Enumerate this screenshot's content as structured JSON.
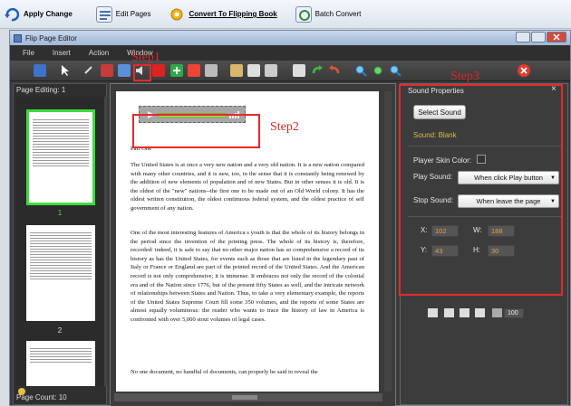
{
  "toolbar": {
    "apply_change": "Apply Change",
    "edit_pages": "Edit Pages",
    "convert": "Convert To Flipping Book",
    "batch_convert": "Batch Convert"
  },
  "window": {
    "title": "Flip Page Editor"
  },
  "menu": [
    "File",
    "Insert",
    "Action",
    "Window"
  ],
  "left_panel": {
    "page_editing": "Page Editing: 1",
    "page_count": "Page Count: 10",
    "thumbnails": [
      {
        "number": "1",
        "selected": true
      },
      {
        "number": "2",
        "selected": false
      }
    ]
  },
  "page": {
    "part_heading": "Part One",
    "paragraphs": [
      "The United States is at once a very new nation and a very old nation. It is a new nation compared with many other countries, and it is new, too, in the sense that it is constantly being renewed by the addition of new elements of population and of new States. But in other senses it is old. It is the oldest of the \"new\" nations--the first one to be made out of an Old World colony. It has the oldest written constitution, the oldest continuous federal system, and the oldest practice of self    government of any nation.",
      "One of the most interesting features of America    s youth is that the whole of its history belongs in the period since the invention of the printing press. The whole of its history is, therefore, recorded: indeed, it is safe to say that no other major nation has so comprehensive a record of its history as has the United States, for events such as those that are listed in the legendary past of Italy or France or England are part of the printed record of the United States. And the American record is not only comprehensive; it is immense. It embraces not only the record of the colonial era and of the Nation since 1776, but of the present fifty States as well, and the intricate network of relationships between States and Nation. Thus, to take a very elementary example, the reports of the United States Supreme Court fill some 350 volumes, and the reports of some States are almost equally voluminous: the reader who wants to trace the history of law in America is confronted with over 5,000 stout volumes of legal cases.",
      "No one document, no handful of documents, can properly be said to reveal the"
    ]
  },
  "sound_panel": {
    "title": "Sound Properties",
    "select_sound": "Select Sound",
    "sound_value": "Sound: Blank",
    "skin_color_label": "Player Skin Color:",
    "play_sound_label": "Play Sound:",
    "play_sound_value": "When click Play button",
    "stop_sound_label": "Stop Sound:",
    "stop_sound_value": "When leave the page",
    "x_label": "X:",
    "x_value": "102",
    "w_label": "W:",
    "w_value": "188",
    "y_label": "Y:",
    "y_value": "43",
    "h_label": "H:",
    "h_value": "30",
    "opacity_value": "100"
  },
  "annotations": {
    "step1": "Step1",
    "step2": "Step2",
    "step3": "Step3"
  },
  "colors": {
    "accent_red": "#e8282a",
    "sound_bar": "#a8e64f",
    "value_orange": "#e79f4a"
  }
}
